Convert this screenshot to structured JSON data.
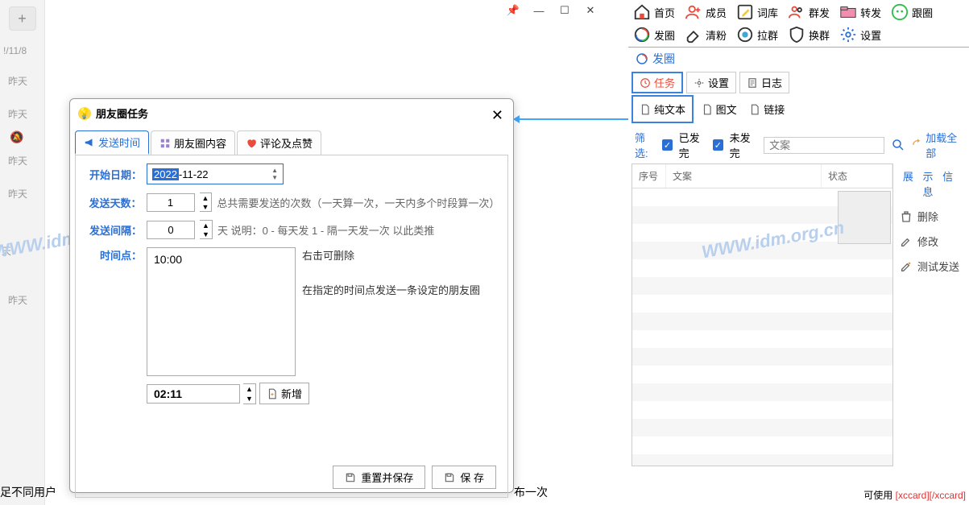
{
  "leftCol": {
    "date": "!/11/8",
    "items": [
      "昨天",
      "昨天",
      "昨天",
      "昨天",
      "天",
      "昨天"
    ]
  },
  "windowControls": {
    "pin": "📌",
    "min": "—",
    "max": "□",
    "close": "✕"
  },
  "toolbar1": [
    {
      "key": "home",
      "label": "首页"
    },
    {
      "key": "members",
      "label": "成员"
    },
    {
      "key": "lexicon",
      "label": "词库"
    },
    {
      "key": "broadcast",
      "label": "群发"
    },
    {
      "key": "forward",
      "label": "转发"
    },
    {
      "key": "moments",
      "label": "跟圈"
    }
  ],
  "toolbar2": [
    {
      "key": "post",
      "label": "发圈"
    },
    {
      "key": "cleanup",
      "label": "清粉"
    },
    {
      "key": "pullgroup",
      "label": "拉群"
    },
    {
      "key": "swapgroup",
      "label": "换群"
    },
    {
      "key": "settings",
      "label": "设置"
    }
  ],
  "sectionTitle": "发圈",
  "subTabs": [
    {
      "key": "task",
      "label": "任务",
      "active": true
    },
    {
      "key": "settings",
      "label": "设置",
      "active": false
    },
    {
      "key": "log",
      "label": "日志",
      "active": false
    }
  ],
  "formatTabs": [
    {
      "key": "text",
      "label": "纯文本"
    },
    {
      "key": "imgtext",
      "label": "图文"
    },
    {
      "key": "link",
      "label": "链接"
    }
  ],
  "filter": {
    "label": "筛选:",
    "sent": "已发完",
    "unsent": "未发完",
    "inputPlaceholder": "文案",
    "loadAll": "加载全部"
  },
  "gridHeaders": [
    "序号",
    "文案",
    "状态"
  ],
  "sideActions": {
    "title": "展 示 信 息",
    "items": [
      {
        "key": "delete",
        "label": "删除"
      },
      {
        "key": "edit",
        "label": "修改"
      },
      {
        "key": "testsend",
        "label": "测试发送"
      }
    ]
  },
  "footer": {
    "label": "可使用",
    "tag": "[xccard][/xccard]"
  },
  "dialog": {
    "title": "朋友圈任务",
    "tabs": [
      {
        "key": "sendtime",
        "label": "发送时间",
        "active": true,
        "color": "#2a6fd6"
      },
      {
        "key": "content",
        "label": "朋友圈内容",
        "active": false
      },
      {
        "key": "comment",
        "label": "评论及点赞",
        "active": false
      }
    ],
    "startLabel": "开始日期：",
    "startYear": "2022",
    "startRest": "-11-22",
    "daysLabel": "发送天数：",
    "daysValue": "1",
    "daysDesc": "总共需要发送的次数（一天算一次，一天内多个时段算一次）",
    "intervalLabel": "发送间隔：",
    "intervalValue": "0",
    "intervalDesc": "天 说明：0 - 每天发 1 - 隔一天发一次 以此类推",
    "timeLabel": "时间点：",
    "times": [
      "10:00"
    ],
    "timeNote1": "右击可删除",
    "timeNote2": "在指定的时间点发送一条设定的朋友圈",
    "newTime": "02:11",
    "addLabel": "新增",
    "resetSave": "重置并保存",
    "save": "保 存"
  },
  "cutText1": "足不同用户",
  "cutText2": "布一次",
  "watermark": "WWW.idm.org.cn"
}
